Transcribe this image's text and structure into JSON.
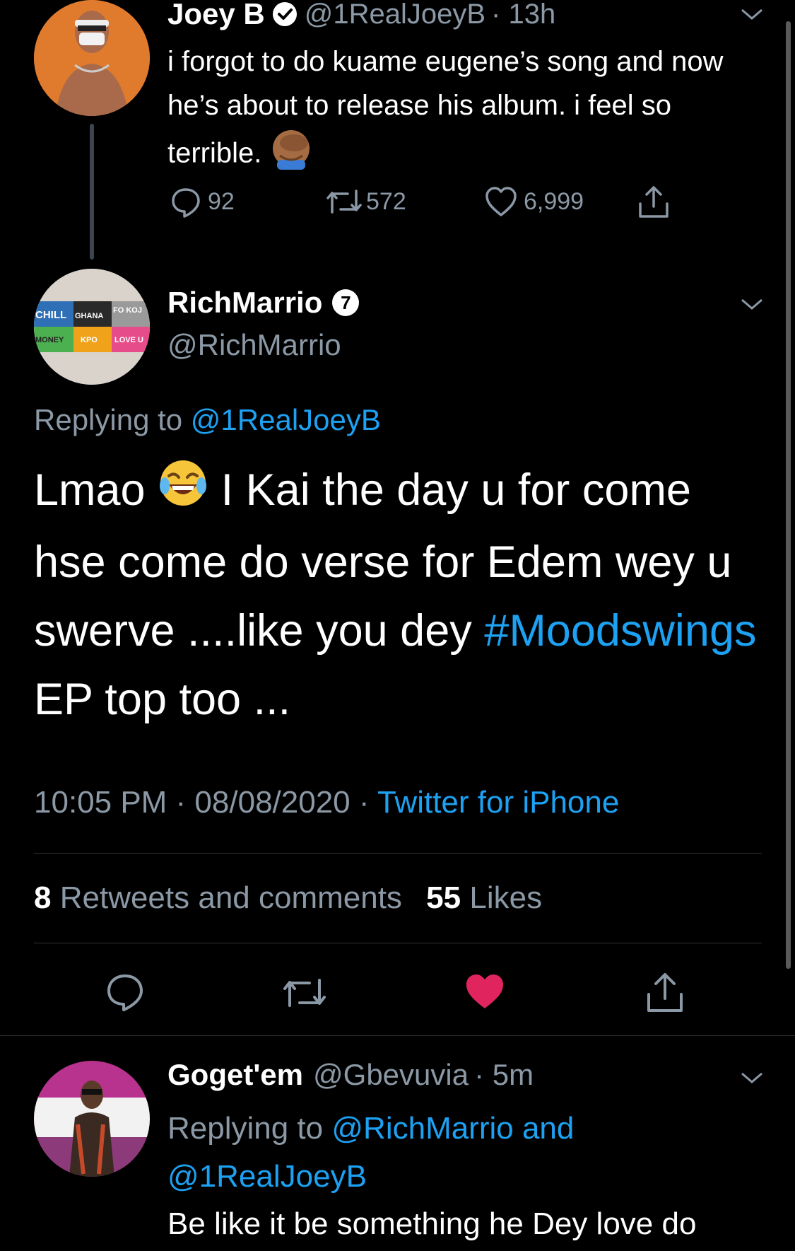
{
  "tweet1": {
    "name": "Joey B",
    "handle": "@1RealJoeyB",
    "time": "· 13h",
    "text": "i forgot to do kuame eugene’s song and now he’s about to release his album. i feel so terrible.",
    "replies": "92",
    "retweets": "572",
    "likes": "6,999"
  },
  "tweet2": {
    "name": "RichMarrio",
    "badge": "7",
    "handle": "@RichMarrio",
    "replying_label": "Replying to",
    "replying_handle": "@1RealJoeyB",
    "text_part1": "Lmao",
    "text_part2": "I Kai the day u for come hse come do verse for Edem wey u swerve ....like you dey",
    "hashtag": "#Moodswings",
    "text_part3": "EP top too ...",
    "timestamp": "10:05 PM · 08/08/2020 ·",
    "client": "Twitter for iPhone",
    "retweets_count": "8",
    "retweets_label": "Retweets and comments",
    "likes_count": "55",
    "likes_label": "Likes",
    "avatar_tiles": [
      "CHILL",
      "GHANA",
      "FO KOJ",
      "MONEY",
      "KPO",
      "LOVE U"
    ]
  },
  "tweet3": {
    "name": "Goget'em",
    "handle": "@Gbevuvia",
    "time": "· 5m",
    "replying_label": "Replying to",
    "replying_handles": "@RichMarrio and",
    "replying_handle2": "@1RealJoeyB",
    "text": "Be like it be something he Dey love do"
  },
  "colors": {
    "accent": "#1da1f2",
    "muted": "#8b98a5",
    "like_red": "#e0245e",
    "background": "#000000"
  },
  "icons": [
    "verified-badge-icon",
    "reply-icon",
    "retweet-icon",
    "like-icon",
    "share-icon",
    "chevron-down-icon"
  ]
}
